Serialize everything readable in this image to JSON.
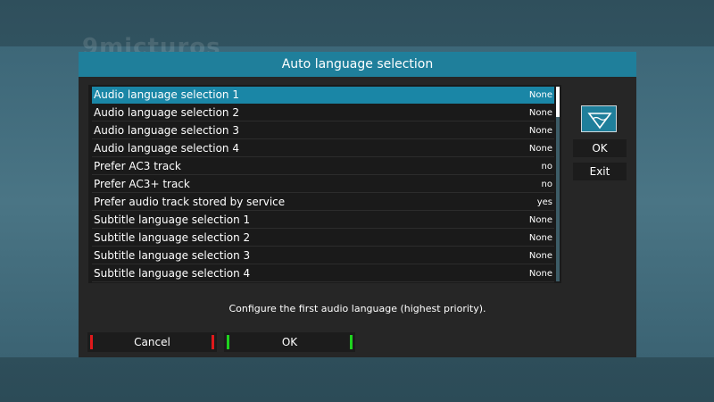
{
  "background": {
    "watermark": "9micturos"
  },
  "dialog": {
    "title": "Auto language selection"
  },
  "settings": [
    {
      "label": "Audio language selection 1",
      "value": "None",
      "selected": true
    },
    {
      "label": "Audio language selection 2",
      "value": "None"
    },
    {
      "label": "Audio language selection 3",
      "value": "None"
    },
    {
      "label": "Audio language selection 4",
      "value": "None"
    },
    {
      "label": "Prefer AC3 track",
      "value": "no"
    },
    {
      "label": "Prefer AC3+ track",
      "value": "no"
    },
    {
      "label": "Prefer audio track stored by service",
      "value": "yes"
    },
    {
      "label": "Subtitle language selection 1",
      "value": "None"
    },
    {
      "label": "Subtitle language selection 2",
      "value": "None"
    },
    {
      "label": "Subtitle language selection 3",
      "value": "None"
    },
    {
      "label": "Subtitle language selection 4",
      "value": "None"
    }
  ],
  "side": {
    "ok_label": "OK",
    "exit_label": "Exit",
    "icon": "keyboard-icon"
  },
  "hint": "Configure the first audio language (highest priority).",
  "footer": {
    "cancel_label": "Cancel",
    "ok_label": "OK"
  },
  "colors": {
    "accent": "#1f7f9b",
    "selection": "#1a86a6",
    "red_key": "#e0191b",
    "green_key": "#1fd31f"
  }
}
